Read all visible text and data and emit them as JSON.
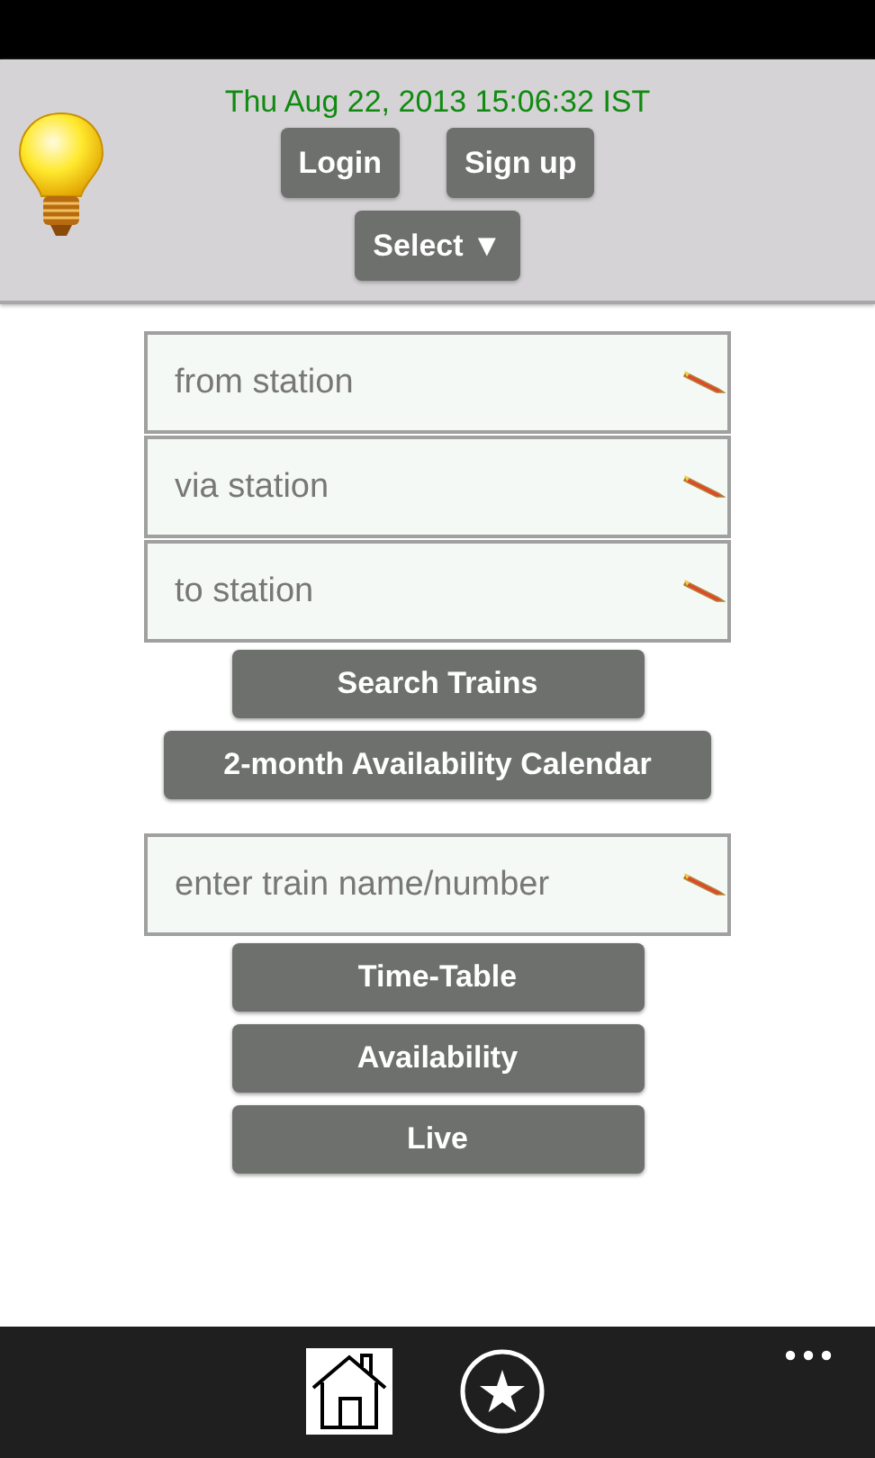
{
  "header": {
    "datetime": "Thu Aug 22, 2013 15:06:32 IST",
    "buttons": [
      "Login",
      "Sign up"
    ],
    "select": "Select ▼"
  },
  "route_fields": [
    {
      "placeholder": "from station"
    },
    {
      "placeholder": "via station"
    },
    {
      "placeholder": "to station"
    }
  ],
  "route_buttons": [
    "Search Trains",
    "2-month Availability Calendar"
  ],
  "train_field": {
    "placeholder": "enter train name/number"
  },
  "train_buttons": [
    "Time-Table",
    "Availability",
    "Live"
  ]
}
